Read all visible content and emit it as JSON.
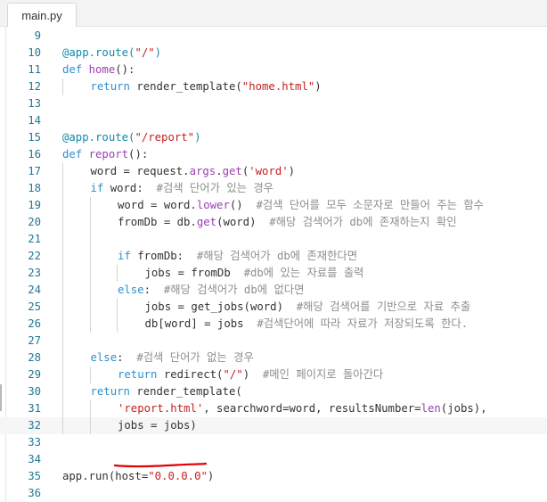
{
  "tab": {
    "label": "main.py"
  },
  "editor": {
    "lines": [
      {
        "num": "9",
        "indent": 0,
        "tokens": []
      },
      {
        "num": "10",
        "indent": 0,
        "tokens": [
          {
            "c": "dec",
            "t": "@app.route("
          },
          {
            "c": "str",
            "t": "\"/\""
          },
          {
            "c": "dec",
            "t": ")"
          }
        ]
      },
      {
        "num": "11",
        "indent": 0,
        "tokens": [
          {
            "c": "kw",
            "t": "def "
          },
          {
            "c": "fn",
            "t": "home"
          },
          {
            "c": "id",
            "t": "():"
          }
        ]
      },
      {
        "num": "12",
        "indent": 1,
        "tokens": [
          {
            "c": "kw",
            "t": "return "
          },
          {
            "c": "id",
            "t": "render_template("
          },
          {
            "c": "str",
            "t": "\"home.html\""
          },
          {
            "c": "id",
            "t": ")"
          }
        ]
      },
      {
        "num": "13",
        "indent": 0,
        "tokens": []
      },
      {
        "num": "14",
        "indent": 0,
        "tokens": []
      },
      {
        "num": "15",
        "indent": 0,
        "tokens": [
          {
            "c": "dec",
            "t": "@app.route("
          },
          {
            "c": "str",
            "t": "\"/report\""
          },
          {
            "c": "dec",
            "t": ")"
          }
        ]
      },
      {
        "num": "16",
        "indent": 0,
        "tokens": [
          {
            "c": "kw",
            "t": "def "
          },
          {
            "c": "fn",
            "t": "report"
          },
          {
            "c": "id",
            "t": "():"
          }
        ]
      },
      {
        "num": "17",
        "indent": 1,
        "tokens": [
          {
            "c": "id",
            "t": "word = request."
          },
          {
            "c": "fn",
            "t": "args"
          },
          {
            "c": "id",
            "t": "."
          },
          {
            "c": "fn",
            "t": "get"
          },
          {
            "c": "id",
            "t": "("
          },
          {
            "c": "str",
            "t": "'word'"
          },
          {
            "c": "id",
            "t": ")"
          }
        ]
      },
      {
        "num": "18",
        "indent": 1,
        "tokens": [
          {
            "c": "kw",
            "t": "if "
          },
          {
            "c": "id",
            "t": "word:  "
          },
          {
            "c": "cm",
            "t": "#검색 단어가 있는 경우"
          }
        ]
      },
      {
        "num": "19",
        "indent": 2,
        "tokens": [
          {
            "c": "id",
            "t": "word = word."
          },
          {
            "c": "fn",
            "t": "lower"
          },
          {
            "c": "id",
            "t": "()  "
          },
          {
            "c": "cm",
            "t": "#검색 단어를 모두 소문자로 만들어 주는 함수"
          }
        ]
      },
      {
        "num": "20",
        "indent": 2,
        "tokens": [
          {
            "c": "id",
            "t": "fromDb = db."
          },
          {
            "c": "fn",
            "t": "get"
          },
          {
            "c": "id",
            "t": "(word)  "
          },
          {
            "c": "cm",
            "t": "#해당 검색어가 db에 존재하는지 확인"
          }
        ]
      },
      {
        "num": "21",
        "indent": 2,
        "tokens": []
      },
      {
        "num": "22",
        "indent": 2,
        "tokens": [
          {
            "c": "kw",
            "t": "if "
          },
          {
            "c": "id",
            "t": "fromDb:  "
          },
          {
            "c": "cm",
            "t": "#해당 검색어가 db에 존재한다면"
          }
        ]
      },
      {
        "num": "23",
        "indent": 3,
        "tokens": [
          {
            "c": "id",
            "t": "jobs = fromDb  "
          },
          {
            "c": "cm",
            "t": "#db에 있는 자료를 출력"
          }
        ]
      },
      {
        "num": "24",
        "indent": 2,
        "tokens": [
          {
            "c": "kw",
            "t": "else"
          },
          {
            "c": "id",
            "t": ":  "
          },
          {
            "c": "cm",
            "t": "#해당 검색어가 db에 없다면"
          }
        ]
      },
      {
        "num": "25",
        "indent": 3,
        "tokens": [
          {
            "c": "id",
            "t": "jobs = get_jobs(word)  "
          },
          {
            "c": "cm",
            "t": "#해당 검색어를 기반으로 자료 추출"
          }
        ]
      },
      {
        "num": "26",
        "indent": 3,
        "tokens": [
          {
            "c": "id",
            "t": "db[word] = jobs  "
          },
          {
            "c": "cm",
            "t": "#검색단어에 따라 자료가 저장되도록 한다."
          }
        ]
      },
      {
        "num": "27",
        "indent": 1,
        "tokens": []
      },
      {
        "num": "28",
        "indent": 1,
        "tokens": [
          {
            "c": "kw",
            "t": "else"
          },
          {
            "c": "id",
            "t": ":  "
          },
          {
            "c": "cm",
            "t": "#검색 단어가 없는 경우"
          }
        ]
      },
      {
        "num": "29",
        "indent": 2,
        "tokens": [
          {
            "c": "kw",
            "t": "return "
          },
          {
            "c": "id",
            "t": "redirect("
          },
          {
            "c": "str",
            "t": "\"/\""
          },
          {
            "c": "id",
            "t": ")  "
          },
          {
            "c": "cm",
            "t": "#메인 페이지로 돌아간다"
          }
        ]
      },
      {
        "num": "30",
        "indent": 1,
        "tokens": [
          {
            "c": "kw",
            "t": "return "
          },
          {
            "c": "id",
            "t": "render_template("
          }
        ]
      },
      {
        "num": "31",
        "indent": 2,
        "tokens": [
          {
            "c": "str",
            "t": "'report.html'"
          },
          {
            "c": "id",
            "t": ", searchword=word, resultsNumber="
          },
          {
            "c": "fn",
            "t": "len"
          },
          {
            "c": "id",
            "t": "(jobs),"
          }
        ]
      },
      {
        "num": "32",
        "indent": 2,
        "current": true,
        "tokens": [
          {
            "c": "id",
            "t": "jobs = jobs)"
          }
        ]
      },
      {
        "num": "33",
        "indent": 0,
        "tokens": []
      },
      {
        "num": "34",
        "indent": 0,
        "tokens": []
      },
      {
        "num": "35",
        "indent": 0,
        "tokens": [
          {
            "c": "id",
            "t": "app.run(host="
          },
          {
            "c": "str",
            "t": "\"0.0.0.0\""
          },
          {
            "c": "id",
            "t": ")"
          }
        ]
      },
      {
        "num": "36",
        "indent": 0,
        "tokens": []
      }
    ]
  },
  "colors": {
    "decorator": "#0e8aa8",
    "keyword": "#2f8fd0",
    "function": "#9b3fb0",
    "string": "#c42121",
    "comment": "#8e8e8e",
    "line_number": "#237893",
    "annotation_underline": "#e00000"
  }
}
